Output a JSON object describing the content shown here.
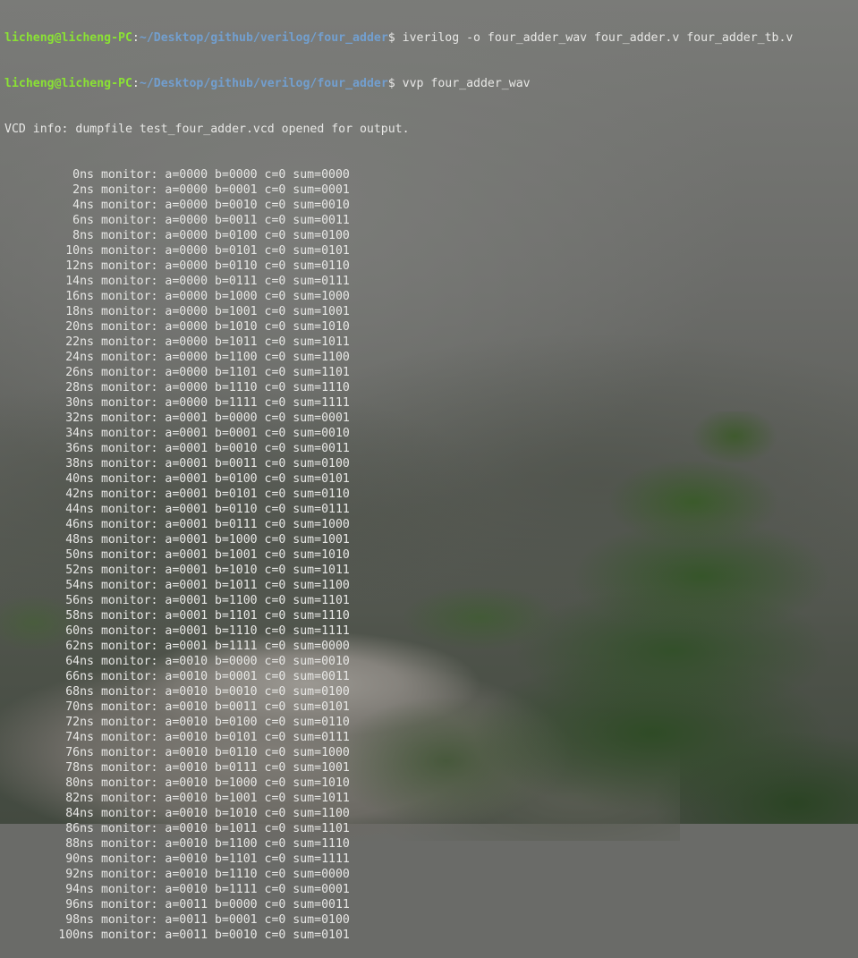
{
  "terminal": {
    "prompts": [
      {
        "user_host": "licheng@licheng-PC",
        "colon": ":",
        "path": "~/Desktop/github/verilog/four_adder",
        "symbol": "$ ",
        "command": "iverilog -o four_adder_wav four_adder.v four_adder_tb.v"
      },
      {
        "user_host": "licheng@licheng-PC",
        "colon": ":",
        "path": "~/Desktop/github/verilog/four_adder",
        "symbol": "$ ",
        "command": "vvp four_adder_wav"
      }
    ],
    "info_line": "VCD info: dumpfile test_four_adder.vcd opened for output.",
    "monitor_lines": [
      {
        "time": "0ns",
        "text": " monitor: a=0000 b=0000 c=0 sum=0000"
      },
      {
        "time": "2ns",
        "text": " monitor: a=0000 b=0001 c=0 sum=0001"
      },
      {
        "time": "4ns",
        "text": " monitor: a=0000 b=0010 c=0 sum=0010"
      },
      {
        "time": "6ns",
        "text": " monitor: a=0000 b=0011 c=0 sum=0011"
      },
      {
        "time": "8ns",
        "text": " monitor: a=0000 b=0100 c=0 sum=0100"
      },
      {
        "time": "10ns",
        "text": " monitor: a=0000 b=0101 c=0 sum=0101"
      },
      {
        "time": "12ns",
        "text": " monitor: a=0000 b=0110 c=0 sum=0110"
      },
      {
        "time": "14ns",
        "text": " monitor: a=0000 b=0111 c=0 sum=0111"
      },
      {
        "time": "16ns",
        "text": " monitor: a=0000 b=1000 c=0 sum=1000"
      },
      {
        "time": "18ns",
        "text": " monitor: a=0000 b=1001 c=0 sum=1001"
      },
      {
        "time": "20ns",
        "text": " monitor: a=0000 b=1010 c=0 sum=1010"
      },
      {
        "time": "22ns",
        "text": " monitor: a=0000 b=1011 c=0 sum=1011"
      },
      {
        "time": "24ns",
        "text": " monitor: a=0000 b=1100 c=0 sum=1100"
      },
      {
        "time": "26ns",
        "text": " monitor: a=0000 b=1101 c=0 sum=1101"
      },
      {
        "time": "28ns",
        "text": " monitor: a=0000 b=1110 c=0 sum=1110"
      },
      {
        "time": "30ns",
        "text": " monitor: a=0000 b=1111 c=0 sum=1111"
      },
      {
        "time": "32ns",
        "text": " monitor: a=0001 b=0000 c=0 sum=0001"
      },
      {
        "time": "34ns",
        "text": " monitor: a=0001 b=0001 c=0 sum=0010"
      },
      {
        "time": "36ns",
        "text": " monitor: a=0001 b=0010 c=0 sum=0011"
      },
      {
        "time": "38ns",
        "text": " monitor: a=0001 b=0011 c=0 sum=0100"
      },
      {
        "time": "40ns",
        "text": " monitor: a=0001 b=0100 c=0 sum=0101"
      },
      {
        "time": "42ns",
        "text": " monitor: a=0001 b=0101 c=0 sum=0110"
      },
      {
        "time": "44ns",
        "text": " monitor: a=0001 b=0110 c=0 sum=0111"
      },
      {
        "time": "46ns",
        "text": " monitor: a=0001 b=0111 c=0 sum=1000"
      },
      {
        "time": "48ns",
        "text": " monitor: a=0001 b=1000 c=0 sum=1001"
      },
      {
        "time": "50ns",
        "text": " monitor: a=0001 b=1001 c=0 sum=1010"
      },
      {
        "time": "52ns",
        "text": " monitor: a=0001 b=1010 c=0 sum=1011"
      },
      {
        "time": "54ns",
        "text": " monitor: a=0001 b=1011 c=0 sum=1100"
      },
      {
        "time": "56ns",
        "text": " monitor: a=0001 b=1100 c=0 sum=1101"
      },
      {
        "time": "58ns",
        "text": " monitor: a=0001 b=1101 c=0 sum=1110"
      },
      {
        "time": "60ns",
        "text": " monitor: a=0001 b=1110 c=0 sum=1111"
      },
      {
        "time": "62ns",
        "text": " monitor: a=0001 b=1111 c=0 sum=0000"
      },
      {
        "time": "64ns",
        "text": " monitor: a=0010 b=0000 c=0 sum=0010"
      },
      {
        "time": "66ns",
        "text": " monitor: a=0010 b=0001 c=0 sum=0011"
      },
      {
        "time": "68ns",
        "text": " monitor: a=0010 b=0010 c=0 sum=0100"
      },
      {
        "time": "70ns",
        "text": " monitor: a=0010 b=0011 c=0 sum=0101"
      },
      {
        "time": "72ns",
        "text": " monitor: a=0010 b=0100 c=0 sum=0110"
      },
      {
        "time": "74ns",
        "text": " monitor: a=0010 b=0101 c=0 sum=0111"
      },
      {
        "time": "76ns",
        "text": " monitor: a=0010 b=0110 c=0 sum=1000"
      },
      {
        "time": "78ns",
        "text": " monitor: a=0010 b=0111 c=0 sum=1001"
      },
      {
        "time": "80ns",
        "text": " monitor: a=0010 b=1000 c=0 sum=1010"
      },
      {
        "time": "82ns",
        "text": " monitor: a=0010 b=1001 c=0 sum=1011"
      },
      {
        "time": "84ns",
        "text": " monitor: a=0010 b=1010 c=0 sum=1100"
      },
      {
        "time": "86ns",
        "text": " monitor: a=0010 b=1011 c=0 sum=1101"
      },
      {
        "time": "88ns",
        "text": " monitor: a=0010 b=1100 c=0 sum=1110"
      },
      {
        "time": "90ns",
        "text": " monitor: a=0010 b=1101 c=0 sum=1111"
      },
      {
        "time": "92ns",
        "text": " monitor: a=0010 b=1110 c=0 sum=0000"
      },
      {
        "time": "94ns",
        "text": " monitor: a=0010 b=1111 c=0 sum=0001"
      },
      {
        "time": "96ns",
        "text": " monitor: a=0011 b=0000 c=0 sum=0011"
      },
      {
        "time": "98ns",
        "text": " monitor: a=0011 b=0001 c=0 sum=0100"
      },
      {
        "time": "100ns",
        "text": " monitor: a=0011 b=0010 c=0 sum=0101"
      }
    ]
  },
  "colors": {
    "prompt_user": "#8ae234",
    "prompt_path": "#729fcf",
    "text": "#e8e8e6"
  }
}
